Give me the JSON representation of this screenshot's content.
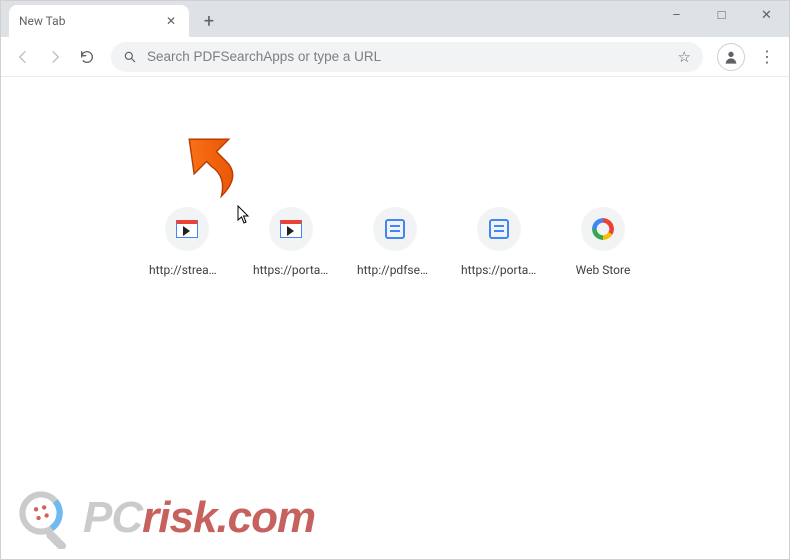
{
  "window": {
    "minimize": "–",
    "maximize": "□",
    "close": "✕"
  },
  "tab": {
    "title": "New Tab",
    "close": "✕",
    "new": "+"
  },
  "toolbar": {
    "back": "←",
    "forward": "→",
    "reload": "⟳",
    "search_glyph": "🔍",
    "omnibox_placeholder": "Search PDFSearchApps or type a URL",
    "star": "☆",
    "avatar": "👤",
    "menu": "⋮"
  },
  "tiles": [
    {
      "label": "http://streams...",
      "icon": "play"
    },
    {
      "label": "https://portal....",
      "icon": "play"
    },
    {
      "label": "http://pdfsear...",
      "icon": "doc"
    },
    {
      "label": "https://portal....",
      "icon": "doc"
    },
    {
      "label": "Web Store",
      "icon": "store"
    }
  ],
  "watermark": {
    "prefix": "PC",
    "suffix": "risk.com"
  }
}
